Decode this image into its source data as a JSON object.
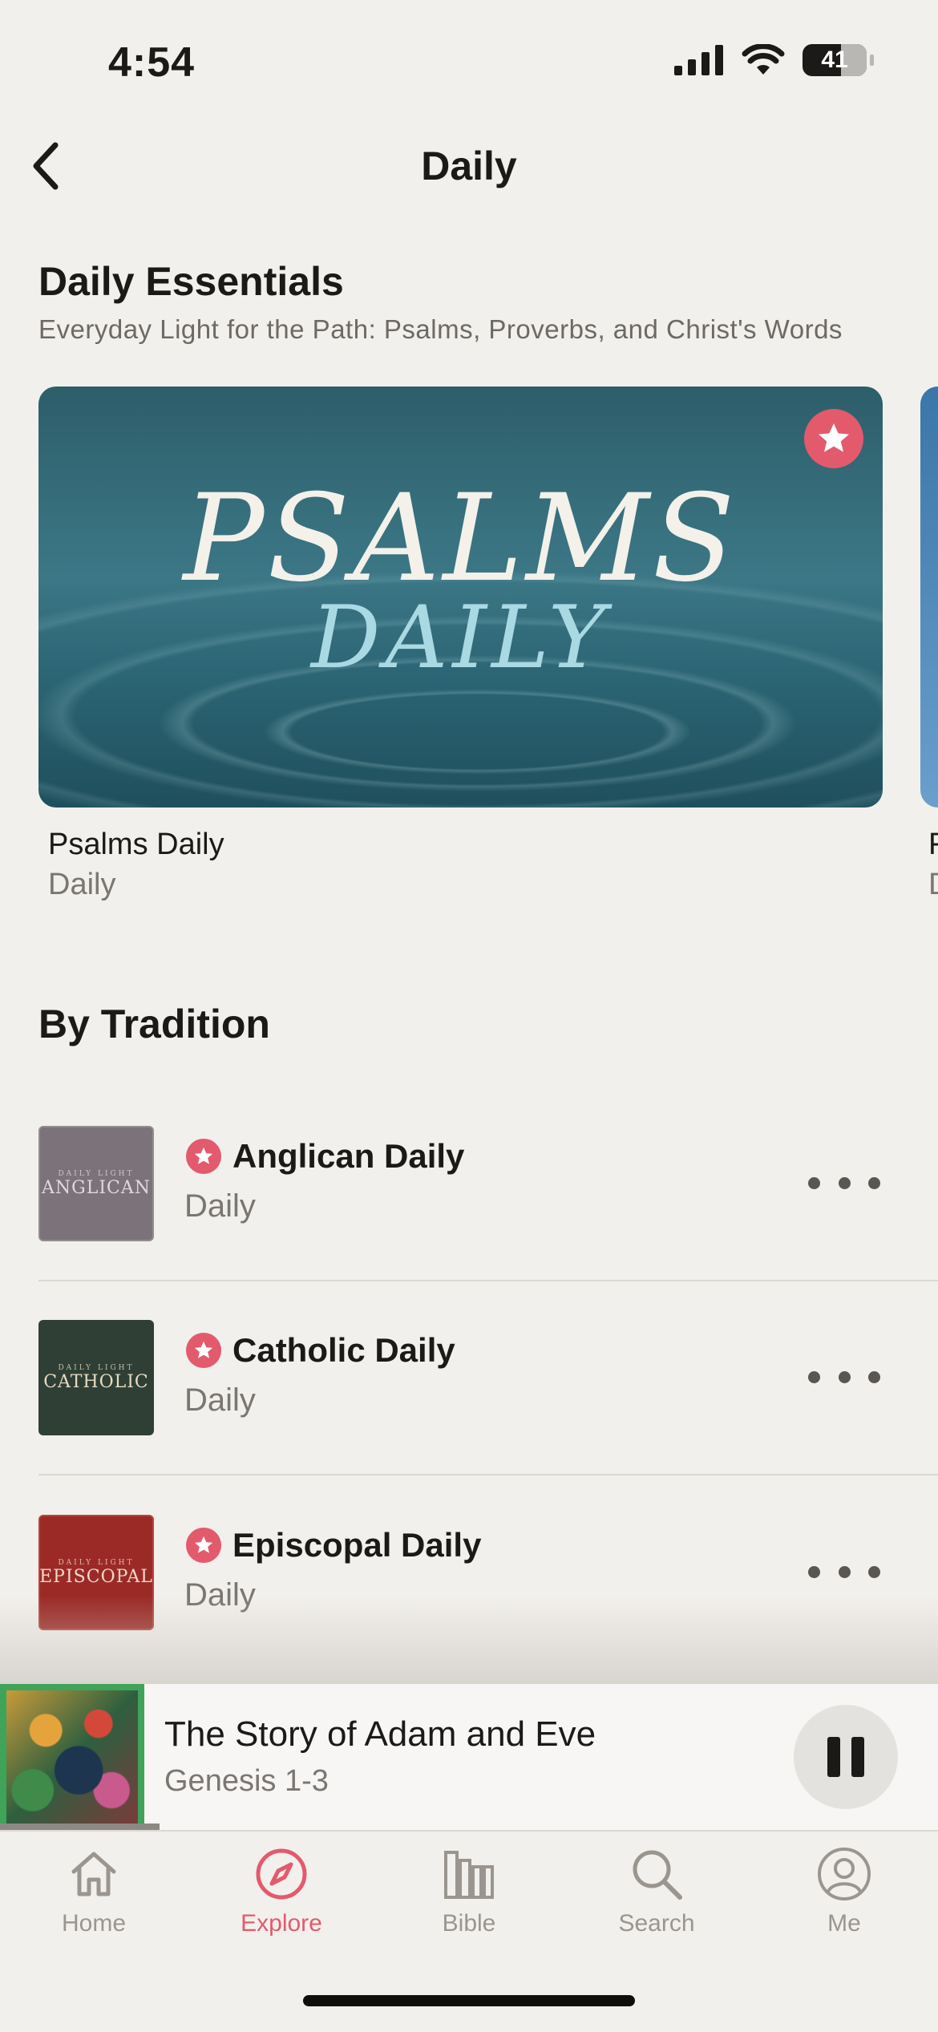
{
  "status_bar": {
    "time": "4:54",
    "battery": "41"
  },
  "nav": {
    "title": "Daily"
  },
  "daily_essentials": {
    "title": "Daily Essentials",
    "subtitle": "Everyday Light for the Path: Psalms, Proverbs, and Christ's Words",
    "card": {
      "art_line1": "PSALMS",
      "art_line2": "DAILY",
      "title": "Psalms Daily",
      "subtitle": "Daily"
    },
    "peek_card": {
      "title_initial": "F",
      "subtitle_initial": "D"
    }
  },
  "by_tradition": {
    "title": "By Tradition",
    "items": [
      {
        "art_small": "DAILY LIGHT",
        "art_big": "ANGLICAN",
        "title": "Anglican Daily",
        "subtitle": "Daily",
        "art_color": "#7b7379"
      },
      {
        "art_small": "DAILY LIGHT",
        "art_big": "CATHOLIC",
        "title": "Catholic Daily",
        "subtitle": "Daily",
        "art_color": "#2f3f35"
      },
      {
        "art_small": "DAILY LIGHT",
        "art_big": "EPISCOPAL",
        "title": "Episcopal Daily",
        "subtitle": "Daily",
        "art_color": "#9b2a27"
      }
    ]
  },
  "mini_player": {
    "title": "The Story of Adam and Eve",
    "subtitle": "Genesis 1-3",
    "progress": 0.17
  },
  "tab_bar": {
    "tabs": [
      {
        "label": "Home",
        "icon": "home-icon",
        "active": false
      },
      {
        "label": "Explore",
        "icon": "compass-icon",
        "active": true
      },
      {
        "label": "Bible",
        "icon": "books-icon",
        "active": false
      },
      {
        "label": "Search",
        "icon": "search-icon",
        "active": false
      },
      {
        "label": "Me",
        "icon": "person-icon",
        "active": false
      }
    ]
  },
  "colors": {
    "accent": "#e35a6d",
    "background": "#f2f0ec"
  }
}
